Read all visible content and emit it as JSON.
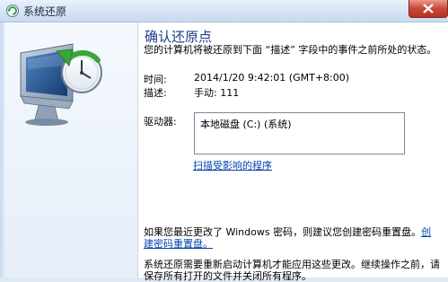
{
  "window": {
    "title": "系统还原"
  },
  "main": {
    "heading": "确认还原点",
    "description": "您的计算机将被还原到下面 “描述” 字段中的事件之前所处的状态。",
    "time_label": "时间:",
    "time_value": "2014/1/20 9:42:01 (GMT+8:00)",
    "desc_label": "描述:",
    "desc_value": "手动: 111",
    "drives_label": "驱动器:",
    "drives": [
      "本地磁盘 (C:) (系统)"
    ],
    "scan_link": "扫描受影响的程序",
    "password_text": "如果您最近更改了 Windows 密码，则建议您创建密码重置盘。",
    "password_link": "创建密码重置盘。",
    "restart_text": "系统还原需要重新启动计算机才能应用这些更改。继续操作之前，请保存所有打开的文件并关闭所有程序。"
  },
  "colors": {
    "heading": "#1e3a8a",
    "link": "#0645ad",
    "close_button": "#c8493a"
  },
  "icons": [
    "system-restore-icon",
    "computer-clock-restore-icon",
    "close-icon"
  ]
}
